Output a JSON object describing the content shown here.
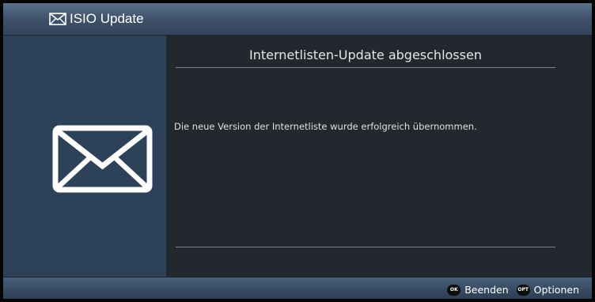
{
  "header": {
    "title": "ISIO Update",
    "icon": "envelope-icon"
  },
  "side_panel": {
    "icon": "envelope-icon"
  },
  "dialog": {
    "title": "Internetlisten-Update abgeschlossen",
    "message": "Die neue Version der Internetliste wurde erfolgreich übernommen."
  },
  "footer": {
    "ok_key": "OK",
    "ok_label": "Beenden",
    "opt_key": "OPT",
    "opt_label": "Optionen"
  },
  "colors": {
    "header_bg": "#3d5068",
    "side_panel_bg": "#2d4158",
    "content_bg": "#23272e",
    "text": "#ffffff"
  }
}
